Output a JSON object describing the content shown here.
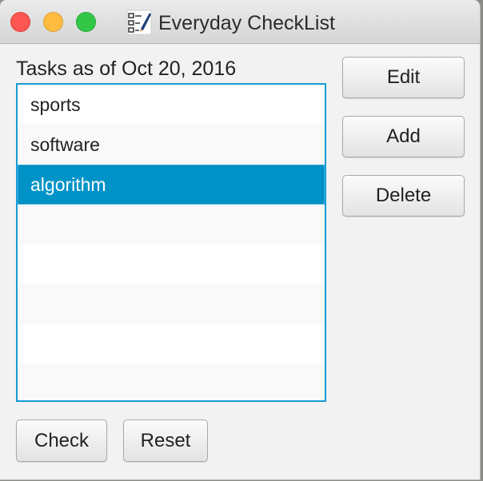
{
  "window": {
    "title": "Everyday CheckList",
    "icon": "checklist-app-icon"
  },
  "traffic_lights": {
    "close_color": "#fc5753",
    "minimize_color": "#fdbc40",
    "maximize_color": "#33c748"
  },
  "tasks": {
    "label": "Tasks as of Oct 20, 2016",
    "items": [
      {
        "label": "sports",
        "selected": false
      },
      {
        "label": "software",
        "selected": false
      },
      {
        "label": "algorithm",
        "selected": true
      }
    ],
    "selection_color": "#0093c8"
  },
  "buttons": {
    "edit": "Edit",
    "add": "Add",
    "delete": "Delete",
    "check": "Check",
    "reset": "Reset"
  }
}
